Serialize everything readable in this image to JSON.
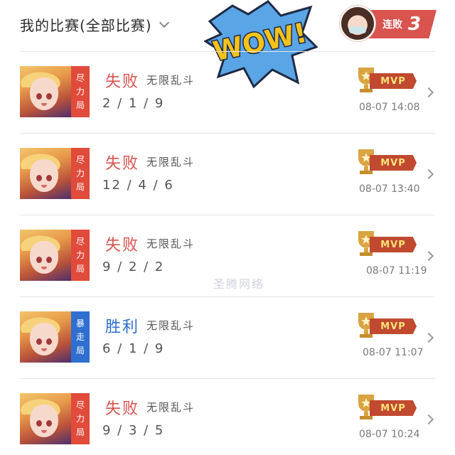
{
  "header": {
    "filter_label": "我的比赛(全部比赛)",
    "sticker_text": "WOW!",
    "streak": {
      "label": "连败",
      "count": "3"
    }
  },
  "colors": {
    "loss": "#d9534f",
    "win": "#2f6fd0",
    "tag_red": "#e14b3b",
    "tag_blue": "#2f6fd0",
    "mvp": "#c0492f"
  },
  "matches": [
    {
      "tag": [
        "尽",
        "力",
        "局"
      ],
      "tag_color": "red",
      "result": "失败",
      "result_type": "loss",
      "mode": "无限乱斗",
      "kda": "2 / 1 / 9",
      "mvp": "MVP",
      "time": "08-07 14:08"
    },
    {
      "tag": [
        "尽",
        "力",
        "局"
      ],
      "tag_color": "red",
      "result": "失败",
      "result_type": "loss",
      "mode": "无限乱斗",
      "kda": "12 / 4 / 6",
      "mvp": "MVP",
      "time": "08-07 13:40"
    },
    {
      "tag": [
        "尽",
        "力",
        "局"
      ],
      "tag_color": "red",
      "result": "失败",
      "result_type": "loss",
      "mode": "无限乱斗",
      "kda": "9 / 2 / 2",
      "mvp": "MVP",
      "time": "08-07 11:19"
    },
    {
      "tag": [
        "暴",
        "走",
        "局"
      ],
      "tag_color": "blue",
      "result": "胜利",
      "result_type": "win",
      "mode": "无限乱斗",
      "kda": "6 / 1 / 9",
      "mvp": "MVP",
      "time": "08-07 11:07"
    },
    {
      "tag": [
        "尽",
        "力",
        "局"
      ],
      "tag_color": "red",
      "result": "失败",
      "result_type": "loss",
      "mode": "无限乱斗",
      "kda": "9 / 3 / 5",
      "mvp": "MVP",
      "time": "08-07 10:24"
    }
  ],
  "watermark": "圣腾网络"
}
